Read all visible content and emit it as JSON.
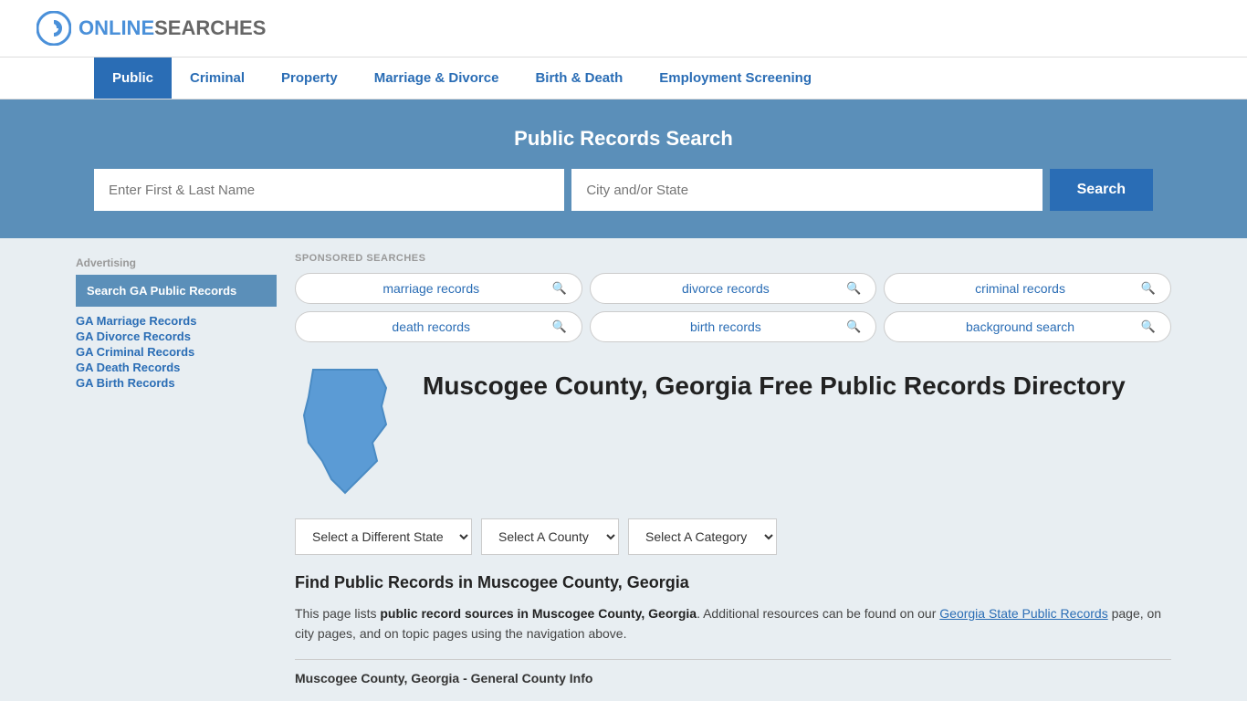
{
  "logo": {
    "online": "ONLINE",
    "searches": "SEARCHES",
    "icon_label": "G logo"
  },
  "nav": {
    "items": [
      {
        "label": "Public",
        "active": true
      },
      {
        "label": "Criminal",
        "active": false
      },
      {
        "label": "Property",
        "active": false
      },
      {
        "label": "Marriage & Divorce",
        "active": false
      },
      {
        "label": "Birth & Death",
        "active": false
      },
      {
        "label": "Employment Screening",
        "active": false
      }
    ]
  },
  "banner": {
    "title": "Public Records Search",
    "name_placeholder": "Enter First & Last Name",
    "city_placeholder": "City and/or State",
    "search_button": "Search"
  },
  "sponsored": {
    "label": "SPONSORED SEARCHES",
    "pills": [
      {
        "text": "marriage records"
      },
      {
        "text": "divorce records"
      },
      {
        "text": "criminal records"
      },
      {
        "text": "death records"
      },
      {
        "text": "birth records"
      },
      {
        "text": "background search"
      }
    ]
  },
  "county": {
    "title": "Muscogee County, Georgia Free Public Records Directory"
  },
  "dropdowns": {
    "state": "Select a Different State",
    "county": "Select A County",
    "category": "Select A Category"
  },
  "find_section": {
    "title": "Find Public Records in Muscogee County, Georgia",
    "text_before": "This page lists ",
    "text_bold": "public record sources in Muscogee County, Georgia",
    "text_after": ". Additional resources can be found on our ",
    "link_text": "Georgia State Public Records",
    "text_end": " page, on city pages, and on topic pages using the navigation above."
  },
  "general_info": {
    "subtitle": "Muscogee County, Georgia - General County Info"
  },
  "sidebar": {
    "ad_label": "Advertising",
    "ad_box": "Search GA Public Records",
    "links": [
      "GA Marriage Records",
      "GA Divorce Records",
      "GA Criminal Records",
      "GA Death Records",
      "GA Birth Records"
    ]
  }
}
